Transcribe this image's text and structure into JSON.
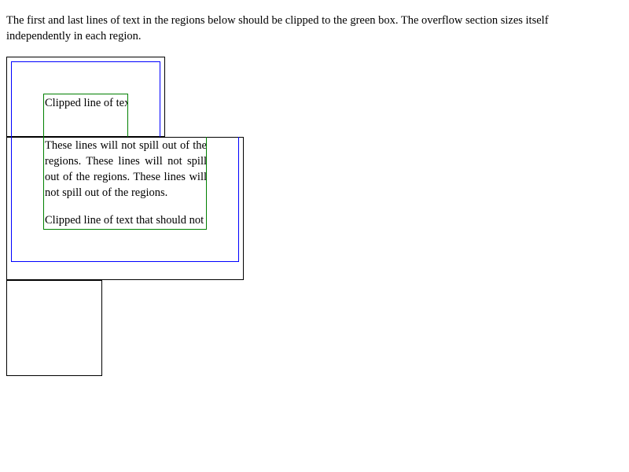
{
  "description": "The first and last lines of text in the regions below should be clipped to the green box. The overflow section sizes itself independently in each region.",
  "regions": {
    "first_clipped_line": "Clipped line of text that should not be visible outside of the green box.",
    "flow_text": "These lines will not spill out of the regions. These lines will not spill out of the regions. These lines will not spill out of the regions.",
    "last_clipped_line": "Clipped line of text that should not be visible outside of the green box."
  },
  "colors": {
    "region_border": "#000000",
    "overflow_box_border": "#0000ff",
    "clip_box_border": "#008000"
  }
}
